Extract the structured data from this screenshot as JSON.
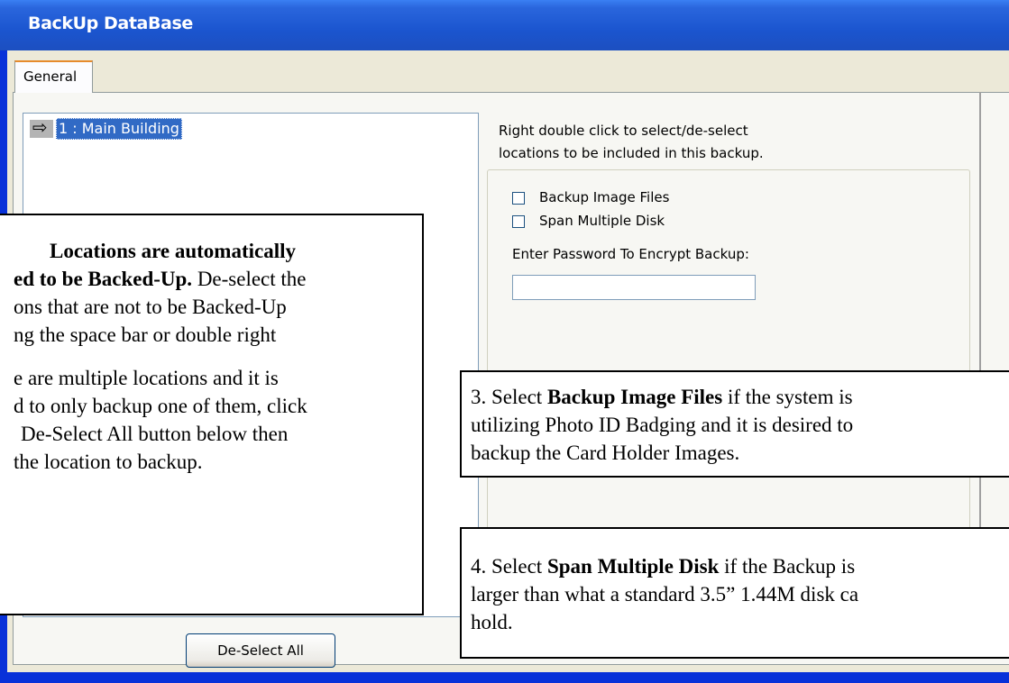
{
  "window": {
    "title": "BackUp DataBase"
  },
  "tabs": [
    {
      "label": "General"
    }
  ],
  "locations": [
    {
      "label": "1 : Main Building",
      "selected": true
    }
  ],
  "hint_lines": [
    "Right double click to select/de-select",
    "locations to be included in this backup."
  ],
  "options": {
    "backup_images": {
      "label": "Backup Image Files",
      "checked": false
    },
    "span_disks": {
      "label": "Span Multiple Disk",
      "checked": false
    },
    "password_label": "Enter Password To Encrypt Backup:",
    "password_value": ""
  },
  "buttons": {
    "deselect_all": "De-Select All"
  },
  "callouts": {
    "c1_line1_bold": "Locations are automatically",
    "c1_line2_bold": "ed to be Backed-Up.",
    "c1_line2_rest": " De-select the",
    "c1_line3": "ons that are not to be Backed-Up",
    "c1_line4": "ng the space bar or double right",
    "c1_line5": "e are multiple locations and it is",
    "c1_line6": "d to only backup one of them, click",
    "c1_line7": "De-Select All button below then",
    "c1_line8": "the location to backup.",
    "c3_pre": "3. Select ",
    "c3_bold": "Backup Image Files",
    "c3_rest1": " if the system is",
    "c3_line2": "utilizing Photo ID Badging and it is desired to",
    "c3_line3": "backup the Card Holder Images.",
    "c4_pre": "4. Select ",
    "c4_bold": "Span Multiple Disk",
    "c4_rest1": " if the Backup is",
    "c4_line2": "larger than what a standard 3.5” 1.44M disk ca",
    "c4_line3": "hold."
  }
}
